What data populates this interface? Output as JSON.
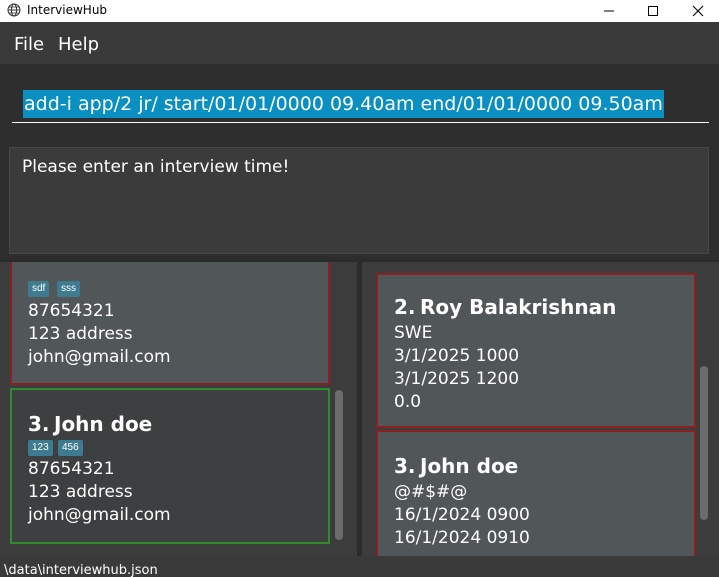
{
  "window": {
    "title": "InterviewHub",
    "icon": "globe-icon"
  },
  "menu": {
    "file": "File",
    "help": "Help"
  },
  "command": {
    "value": "add-i app/2 jr/ start/01/01/0000 09.40am end/01/01/0000 09.50am"
  },
  "result": {
    "message": "Please enter an interview time!"
  },
  "applicants": {
    "items": [
      {
        "tags": [
          "sdf",
          "sss"
        ],
        "phone": "87654321",
        "address": "123 address",
        "email": "john@gmail.com"
      },
      {
        "index": "3.",
        "name": "John doe",
        "tags": [
          "123",
          "456"
        ],
        "phone": "87654321",
        "address": "123 address",
        "email": "john@gmail.com"
      }
    ]
  },
  "interviews": {
    "items": [
      {
        "index": "2.",
        "name": "Roy Balakrishnan",
        "role": "SWE",
        "start": "3/1/2025 1000",
        "end": "3/1/2025 1200",
        "rating": "0.0"
      },
      {
        "index": "3.",
        "name": "John doe",
        "role": "@#$#@",
        "start": "16/1/2024 0900",
        "end": "16/1/2024 0910"
      }
    ]
  },
  "status": {
    "path": "\\data\\interviewhub.json"
  },
  "colors": {
    "accent_selection": "#0a8fc2",
    "selected_border": "#2e8b2e",
    "card_border": "#8b2020",
    "tag_background": "#3e7b91"
  }
}
